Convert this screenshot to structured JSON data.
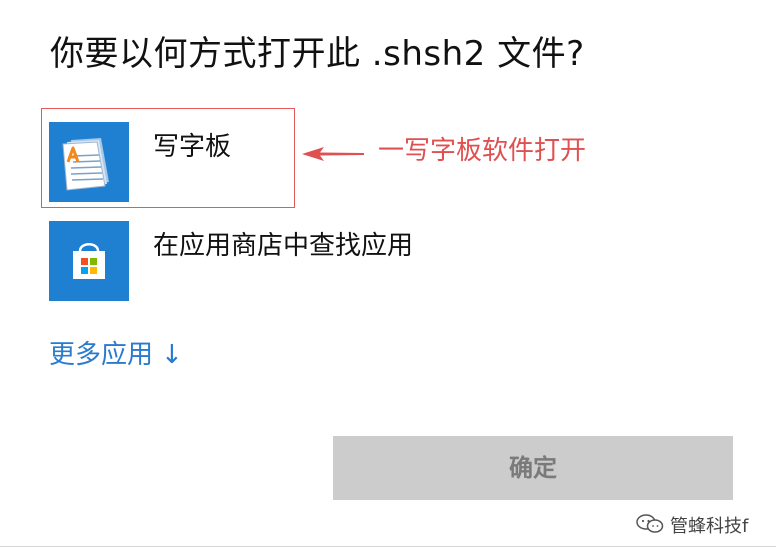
{
  "dialog": {
    "title": "你要以何方式打开此 .shsh2 文件?"
  },
  "apps": [
    {
      "label": "写字板",
      "icon": "wordpad-icon"
    },
    {
      "label": "在应用商店中查找应用",
      "icon": "store-icon"
    }
  ],
  "annotation": {
    "text": "一写字板软件打开",
    "color": "#e05050"
  },
  "more_apps": {
    "label": "更多应用",
    "arrow": "↓"
  },
  "ok_button": {
    "label": "确定"
  },
  "watermark": {
    "text": "管蜂科技f"
  },
  "colors": {
    "accent": "#1f7fd1",
    "link": "#2a7bd0",
    "button_disabled_bg": "#cccccc",
    "button_disabled_text": "#7a7a7a"
  }
}
